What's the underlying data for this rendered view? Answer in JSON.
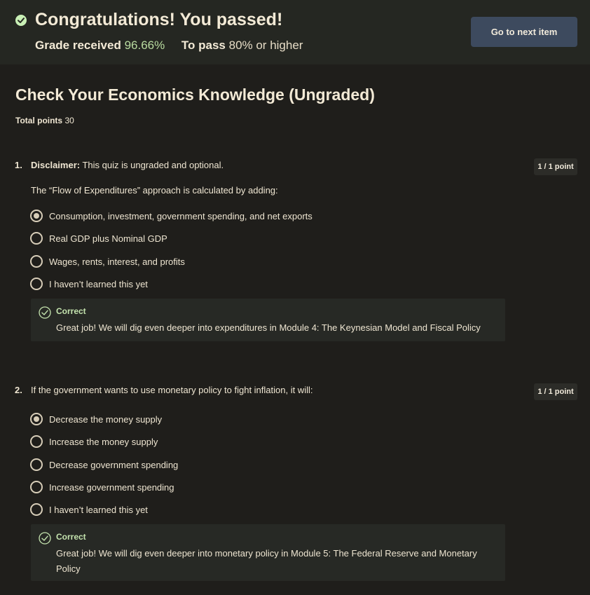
{
  "banner": {
    "title": "Congratulations! You passed!",
    "grade_label": "Grade received",
    "grade_value": "96.66%",
    "pass_label": "To pass",
    "pass_value": "80% or higher",
    "next_button": "Go to next item",
    "check_icon": "check-circle-icon"
  },
  "quiz": {
    "title": "Check Your Economics Knowledge (Ungraded)",
    "total_points_label": "Total points",
    "total_points_value": "30"
  },
  "questions": [
    {
      "number": "1.",
      "prefix": "Disclaimer:",
      "text": "This quiz is ungraded and optional.",
      "subtext": "The “Flow of Expenditures” approach is calculated by adding:",
      "points": "1 / 1 point",
      "options": [
        {
          "label": "Consumption, investment, government spending, and net exports",
          "selected": true
        },
        {
          "label": "Real GDP plus Nominal GDP",
          "selected": false
        },
        {
          "label": "Wages, rents, interest, and profits",
          "selected": false
        },
        {
          "label": "I haven’t learned this yet",
          "selected": false
        }
      ],
      "feedback": {
        "status": "Correct",
        "text": "Great job! We will dig even deeper into expenditures in Module 4: The Keynesian Model and Fiscal Policy"
      }
    },
    {
      "number": "2.",
      "prefix": "",
      "text": "If the government wants to use monetary policy to fight inflation, it will:",
      "subtext": "",
      "points": "1 / 1 point",
      "options": [
        {
          "label": "Decrease the money supply",
          "selected": true
        },
        {
          "label": "Increase the money supply",
          "selected": false
        },
        {
          "label": "Decrease government spending",
          "selected": false
        },
        {
          "label": "Increase government spending",
          "selected": false
        },
        {
          "label": "I haven’t learned this yet",
          "selected": false
        }
      ],
      "feedback": {
        "status": "Correct",
        "text": "Great job! We will dig even deeper into monetary policy in Module 5: The Federal Reserve and Monetary Policy"
      }
    }
  ],
  "colors": {
    "background": "#1f1e1b",
    "banner": "#252722",
    "button": "#3d4a5e",
    "correct_green": "#c4e3ae",
    "text": "#efe6d2"
  }
}
